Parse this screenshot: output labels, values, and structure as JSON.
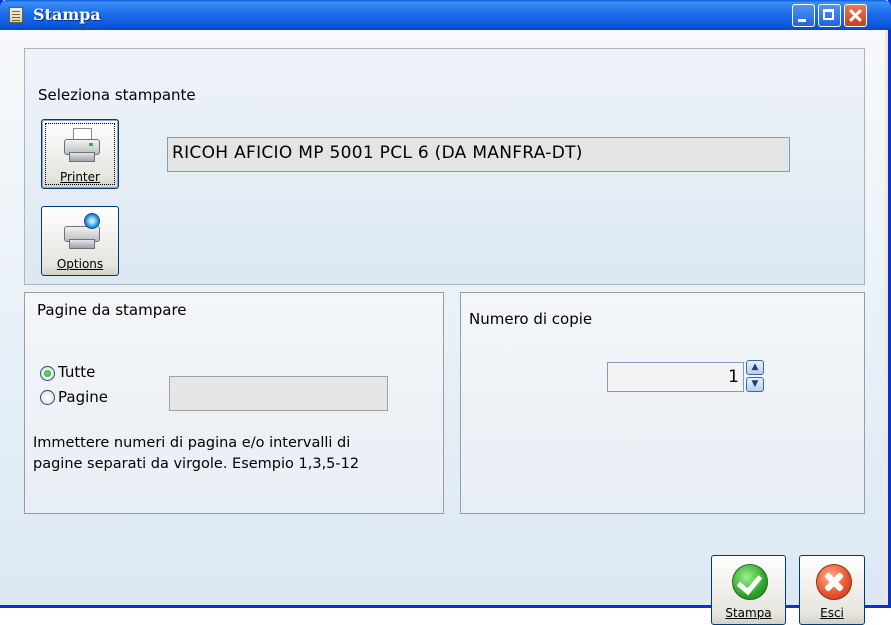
{
  "window": {
    "title": "Stampa",
    "icon": "document-icon",
    "controls": [
      "minimize",
      "maximize",
      "close"
    ]
  },
  "printer_section": {
    "label": "Seleziona stampante",
    "printer_button_label": "Printer",
    "options_button_label": "Options",
    "selected_printer": "RICOH AFICIO MP 5001 PCL 6 (DA MANFRA-DT)"
  },
  "pages_section": {
    "label": "Pagine da stampare",
    "radio_all_label": "Tutte",
    "radio_pages_label": "Pagine",
    "selected_option": "Tutte",
    "pages_value": "",
    "hint_line1": "Immettere numeri di pagina e/o intervalli di",
    "hint_line2": "pagine separati da virgole. Esempio 1,3,5-12"
  },
  "copies_section": {
    "label": "Numero di copie",
    "value": "1"
  },
  "footer": {
    "print_button_label": "Stampa",
    "exit_button_label": "Esci"
  }
}
